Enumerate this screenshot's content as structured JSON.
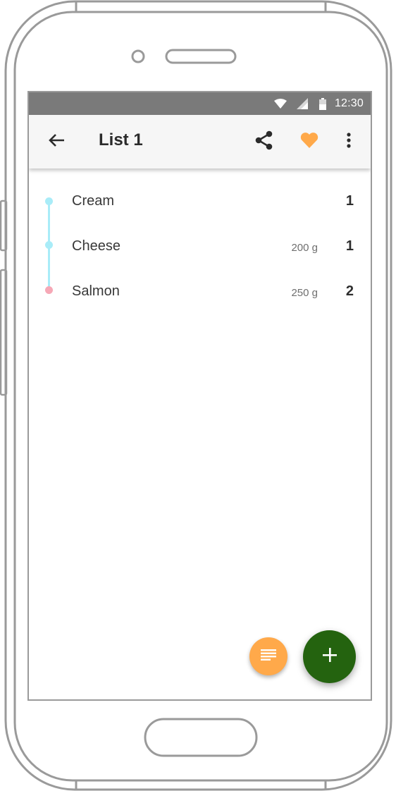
{
  "status_bar": {
    "time": "12:30",
    "icons": [
      "wifi-icon",
      "signal-icon",
      "battery-icon"
    ]
  },
  "app_bar": {
    "title": "List 1",
    "back_icon": "arrow-back-icon",
    "actions": [
      "share-icon",
      "heart-icon",
      "more-vertical-icon"
    ]
  },
  "items": [
    {
      "name": "Cream",
      "weight": "",
      "quantity": "1",
      "dot_color": "#a9ecf8"
    },
    {
      "name": "Cheese",
      "weight": "200 g",
      "quantity": "1",
      "dot_color": "#a9ecf8"
    },
    {
      "name": "Salmon",
      "weight": "250 g",
      "quantity": "2",
      "dot_color": "#f6a8b6"
    }
  ],
  "fabs": {
    "secondary": {
      "icon": "notes-icon",
      "color": "#ffa94a"
    },
    "primary": {
      "icon": "plus-icon",
      "color": "#24630f"
    }
  },
  "colors": {
    "status_bar": "#7a7a7a",
    "app_bar": "#f6f6f6",
    "accent_heart": "#ffa94a",
    "timeline": "#a9ecf8"
  }
}
